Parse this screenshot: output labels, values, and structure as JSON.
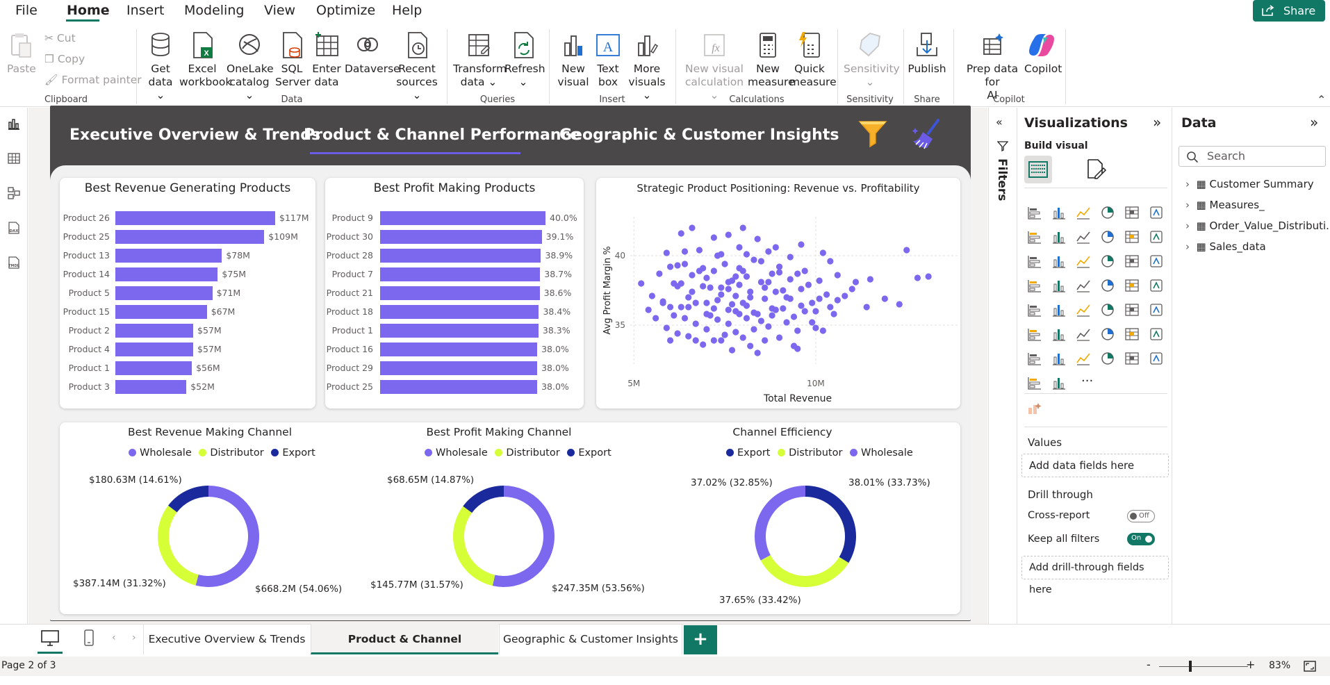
{
  "menu": {
    "items": [
      "File",
      "Home",
      "Insert",
      "Modeling",
      "View",
      "Optimize",
      "Help"
    ],
    "active": "Home",
    "share_label": "Share"
  },
  "ribbon": {
    "clipboard": {
      "paste": "Paste",
      "cut": "Cut",
      "copy": "Copy",
      "format_painter": "Format painter",
      "group": "Clipboard"
    },
    "data": {
      "get_data": [
        "Get",
        "data ⌄"
      ],
      "excel": [
        "Excel",
        "workbook"
      ],
      "onelake": [
        "OneLake",
        "catalog ⌄"
      ],
      "sql": [
        "SQL",
        "Server"
      ],
      "enter": [
        "Enter",
        "data"
      ],
      "dataverse": [
        "Dataverse",
        ""
      ],
      "recent": [
        "Recent",
        "sources ⌄"
      ],
      "group": "Data"
    },
    "queries": {
      "transform": [
        "Transform",
        "data ⌄"
      ],
      "refresh": [
        "Refresh",
        "⌄"
      ],
      "group": "Queries"
    },
    "insert": {
      "new_visual": [
        "New",
        "visual"
      ],
      "text_box": [
        "Text",
        "box"
      ],
      "more_visuals": [
        "More",
        "visuals ⌄"
      ],
      "group": "Insert"
    },
    "calculations": {
      "new_visual_calc": [
        "New visual",
        "calculation ⌄"
      ],
      "new_measure": [
        "New",
        "measure"
      ],
      "quick_measure": [
        "Quick",
        "measure"
      ],
      "group": "Calculations"
    },
    "sensitivity": {
      "label": [
        "Sensitivity",
        "⌄"
      ],
      "group": "Sensitivity"
    },
    "share": {
      "publish": [
        "Publish",
        ""
      ],
      "group": "Share"
    },
    "copilot": {
      "prep": [
        "Prep data for",
        "AI"
      ],
      "copilot": [
        "Copilot",
        ""
      ],
      "group": "Copilot"
    }
  },
  "report": {
    "nav_tabs": [
      "Executive Overview & Trends",
      "Product & Channel Performance",
      "Geographic & Customer Insights"
    ],
    "active_tab": "Product & Channel Performance"
  },
  "charts": {
    "revenue_title": "Best Revenue Generating Products",
    "profit_title": "Best Profit Making Products",
    "scatter_title": "Strategic Product Positioning: Revenue vs. Profitability",
    "channel_revenue_title": "Best Revenue Making Channel",
    "channel_profit_title": "Best Profit Making Channel",
    "channel_eff_title": "Channel Efficiency"
  },
  "chart_data": [
    {
      "type": "bar",
      "title": "Best Revenue Generating Products",
      "categories": [
        "Product 26",
        "Product 25",
        "Product 13",
        "Product 14",
        "Product 5",
        "Product 15",
        "Product 2",
        "Product 4",
        "Product 1",
        "Product 3"
      ],
      "values": [
        117,
        109,
        78,
        75,
        71,
        67,
        57,
        57,
        56,
        52
      ],
      "labels": [
        "$117M",
        "$109M",
        "$78M",
        "$75M",
        "$71M",
        "$67M",
        "$57M",
        "$57M",
        "$56M",
        "$52M"
      ],
      "color": "#7b68ee"
    },
    {
      "type": "bar",
      "title": "Best Profit Making Products",
      "categories": [
        "Product 9",
        "Product 30",
        "Product 28",
        "Product 7",
        "Product 21",
        "Product 18",
        "Product 1",
        "Product 16",
        "Product 29",
        "Product 25"
      ],
      "values": [
        40.0,
        39.1,
        38.9,
        38.7,
        38.6,
        38.4,
        38.3,
        38.0,
        38.0,
        38.0
      ],
      "labels": [
        "40.0%",
        "39.1%",
        "38.9%",
        "38.7%",
        "38.6%",
        "38.4%",
        "38.3%",
        "38.0%",
        "38.0%",
        "38.0%"
      ],
      "color": "#7b68ee"
    },
    {
      "type": "scatter",
      "title": "Strategic Product Positioning: Revenue vs. Profitability",
      "xlabel": "Total Revenue",
      "ylabel": "Avg Profit Margin %",
      "xticks": [
        "5M",
        "10M"
      ],
      "yticks": [
        "35",
        "40"
      ],
      "xlim": [
        4.9,
        13.9
      ],
      "ylim": [
        32.2,
        42.8
      ],
      "color": "#7b68ee",
      "points": [
        [
          5.9,
          40.2
        ],
        [
          6.0,
          39.2
        ],
        [
          6.1,
          38.0
        ],
        [
          6.3,
          41.6
        ],
        [
          6.5,
          36.3
        ],
        [
          6.6,
          42.0
        ],
        [
          6.9,
          39.1
        ],
        [
          7.2,
          41.3
        ],
        [
          7.4,
          40.1
        ],
        [
          7.6,
          41.5
        ],
        [
          7.8,
          38.5
        ],
        [
          7.9,
          40.6
        ],
        [
          5.5,
          37.1
        ],
        [
          5.7,
          38.7
        ],
        [
          5.8,
          36.6
        ],
        [
          6.1,
          35.7
        ],
        [
          6.2,
          37.8
        ],
        [
          6.3,
          38.0
        ],
        [
          6.4,
          39.4
        ],
        [
          6.6,
          37.4
        ],
        [
          6.7,
          36.6
        ],
        [
          6.8,
          38.9
        ],
        [
          7.0,
          36.6
        ],
        [
          7.1,
          37.7
        ],
        [
          7.2,
          38.9
        ],
        [
          7.3,
          36.8
        ],
        [
          7.4,
          37.7
        ],
        [
          7.5,
          39.4
        ],
        [
          7.6,
          36.1
        ],
        [
          7.7,
          38.2
        ],
        [
          7.8,
          37.1
        ],
        [
          7.9,
          39.1
        ],
        [
          8.0,
          36.6
        ],
        [
          8.1,
          38.5
        ],
        [
          8.2,
          37.4
        ],
        [
          8.3,
          39.7
        ],
        [
          8.4,
          35.8
        ],
        [
          8.5,
          38.1
        ],
        [
          8.6,
          36.9
        ],
        [
          8.8,
          38.7
        ],
        [
          8.9,
          37.4
        ],
        [
          9.0,
          39.2
        ],
        [
          9.1,
          36.2
        ],
        [
          9.3,
          38.3
        ],
        [
          9.4,
          35.6
        ],
        [
          9.6,
          37.6
        ],
        [
          9.7,
          38.9
        ],
        [
          9.9,
          36.6
        ],
        [
          10.1,
          38.2
        ],
        [
          10.3,
          37.2
        ],
        [
          10.4,
          39.6
        ],
        [
          10.6,
          36.8
        ],
        [
          5.2,
          38.0
        ],
        [
          5.4,
          36.1
        ],
        [
          5.6,
          35.5
        ],
        [
          5.9,
          34.8
        ],
        [
          6.0,
          36.3
        ],
        [
          6.2,
          34.4
        ],
        [
          6.4,
          35.5
        ],
        [
          6.5,
          34.2
        ],
        [
          6.7,
          35.1
        ],
        [
          6.9,
          33.6
        ],
        [
          7.0,
          34.7
        ],
        [
          7.1,
          35.7
        ],
        [
          7.2,
          33.9
        ],
        [
          7.3,
          35.4
        ],
        [
          7.5,
          34.3
        ],
        [
          7.6,
          35.1
        ],
        [
          7.7,
          33.2
        ],
        [
          7.8,
          34.5
        ],
        [
          7.9,
          35.8
        ],
        [
          8.0,
          34.1
        ],
        [
          8.1,
          35.5
        ],
        [
          8.2,
          33.5
        ],
        [
          8.3,
          34.7
        ],
        [
          8.5,
          35.3
        ],
        [
          8.6,
          33.9
        ],
        [
          8.7,
          34.9
        ],
        [
          8.8,
          35.7
        ],
        [
          9.0,
          34.1
        ],
        [
          9.2,
          35.2
        ],
        [
          9.4,
          33.5
        ],
        [
          9.5,
          34.6
        ],
        [
          9.7,
          36.0
        ],
        [
          9.9,
          35.2
        ],
        [
          10.2,
          34.6
        ],
        [
          10.4,
          36.3
        ],
        [
          11.5,
          38.3
        ],
        [
          11.9,
          36.9
        ],
        [
          12.3,
          36.5
        ],
        [
          12.8,
          38.4
        ],
        [
          13.1,
          38.5
        ],
        [
          12.5,
          40.4
        ],
        [
          10.2,
          40.2
        ],
        [
          8.0,
          42.0
        ],
        [
          8.4,
          41.2
        ],
        [
          8.9,
          40.6
        ],
        [
          9.3,
          39.9
        ],
        [
          9.6,
          40.8
        ],
        [
          8.7,
          40.3
        ],
        [
          7.3,
          40.0
        ],
        [
          6.8,
          40.4
        ],
        [
          6.4,
          40.3
        ],
        [
          6.9,
          37.8
        ],
        [
          7.6,
          38.1
        ],
        [
          8.1,
          36.4
        ],
        [
          8.6,
          37.7
        ],
        [
          9.8,
          37.9
        ],
        [
          10.6,
          38.6
        ],
        [
          11.0,
          37.6
        ],
        [
          11.4,
          36.3
        ],
        [
          5.8,
          36.7
        ],
        [
          6.6,
          38.6
        ],
        [
          7.4,
          37.2
        ],
        [
          7.8,
          36.0
        ],
        [
          8.0,
          38.9
        ],
        [
          8.8,
          36.2
        ],
        [
          9.2,
          37.0
        ],
        [
          9.5,
          38.7
        ],
        [
          10.0,
          36.0
        ],
        [
          10.8,
          37.1
        ],
        [
          11.1,
          38.1
        ],
        [
          6.2,
          39.3
        ],
        [
          7.0,
          38.4
        ],
        [
          7.9,
          37.9
        ],
        [
          8.5,
          39.6
        ],
        [
          9.0,
          38.8
        ],
        [
          9.3,
          36.9
        ],
        [
          6.7,
          33.9
        ],
        [
          7.4,
          33.9
        ],
        [
          8.4,
          33.0
        ],
        [
          9.5,
          33.3
        ],
        [
          10.0,
          34.8
        ],
        [
          7.0,
          35.8
        ],
        [
          7.7,
          36.5
        ],
        [
          8.3,
          35.9
        ],
        [
          8.9,
          36.1
        ],
        [
          9.1,
          37.5
        ],
        [
          10.1,
          36.9
        ],
        [
          6.0,
          33.9
        ],
        [
          6.5,
          37.0
        ],
        [
          7.2,
          36.2
        ],
        [
          8.2,
          37.0
        ],
        [
          8.7,
          38.1
        ],
        [
          9.6,
          36.4
        ],
        [
          10.5,
          35.8
        ],
        [
          6.3,
          36.3
        ],
        [
          7.6,
          37.6
        ],
        [
          8.1,
          40.1
        ]
      ]
    },
    {
      "type": "pie",
      "title": "Best Revenue Making Channel",
      "categories": [
        "Wholesale",
        "Distributor",
        "Export"
      ],
      "values": [
        54.06,
        31.32,
        14.61
      ],
      "labels": [
        "$668.2M (54.06%)",
        "$387.14M (31.32%)",
        "$180.63M (14.61%)"
      ],
      "colors": [
        "#7b68ee",
        "#d6ff38",
        "#1a2a9c"
      ]
    },
    {
      "type": "pie",
      "title": "Best Profit Making Channel",
      "categories": [
        "Wholesale",
        "Distributor",
        "Export"
      ],
      "values": [
        53.56,
        31.57,
        14.87
      ],
      "labels": [
        "$247.35M (53.56%)",
        "$145.77M (31.57%)",
        "$68.65M (14.87%)"
      ],
      "colors": [
        "#7b68ee",
        "#d6ff38",
        "#1a2a9c"
      ]
    },
    {
      "type": "pie",
      "title": "Channel Efficiency",
      "categories": [
        "Export",
        "Distributor",
        "Wholesale"
      ],
      "values": [
        33.73,
        33.42,
        32.85
      ],
      "labels": [
        "38.01% (33.73%)",
        "37.65% (33.42%)",
        "37.02% (32.85%)"
      ],
      "colors": [
        "#1a2a9c",
        "#d6ff38",
        "#7b68ee"
      ]
    }
  ],
  "filters_pane": {
    "label": "Filters"
  },
  "visualizations": {
    "title": "Visualizations",
    "build_visual": "Build visual",
    "values_label": "Values",
    "values_placeholder": "Add data fields here",
    "drill_through": "Drill through",
    "cross_report": "Cross-report",
    "cross_report_state": "Off",
    "keep_filters": "Keep all filters",
    "keep_filters_state": "On",
    "drill_placeholder": "Add drill-through fields here",
    "more": "···"
  },
  "data_pane": {
    "title": "Data",
    "search_placeholder": "Search",
    "tables": [
      "Customer Summary",
      "Measures_",
      "Order_Value_Distributi...",
      "Sales_data"
    ]
  },
  "pages": {
    "tabs": [
      "Executive Overview & Trends",
      "Product & Channel Performance",
      "Geographic & Customer Insights"
    ],
    "active": "Product & Channel Performance",
    "add": "+"
  },
  "status": {
    "page": "Page 2 of 3",
    "zoom": "83%",
    "minus": "-",
    "plus": "+"
  },
  "colors": {
    "accent": "#117865",
    "purple": "#7b68ee",
    "lime": "#d6ff38",
    "navy": "#1a2a9c",
    "report_header": "#4a4848"
  }
}
